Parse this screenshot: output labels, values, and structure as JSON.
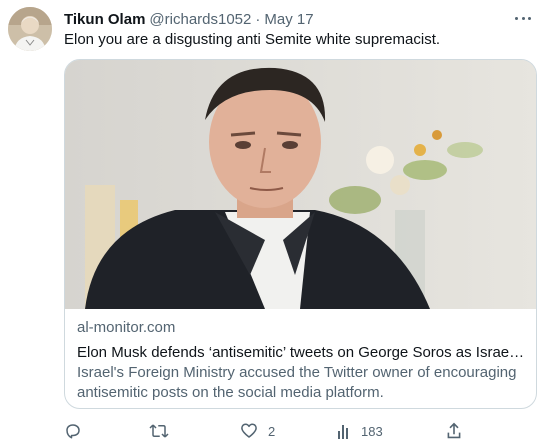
{
  "tweet": {
    "display_name": "Tikun Olam",
    "handle": "@richards1052",
    "separator": "·",
    "date": "May 17",
    "text": "Elon you are a disgusting anti Semite white supremacist.",
    "avatar_icon": "avatar",
    "more_icon": "more-icon"
  },
  "card": {
    "domain": "al-monitor.com",
    "title": "Elon Musk defends ‘antisemitic’ tweets on George Soros as Israel att...",
    "description": "Israel's Foreign Ministry accused the Twitter owner of encouraging antisemitic posts on the social media platform."
  },
  "actions": {
    "reply": {
      "icon": "reply-icon",
      "count": ""
    },
    "retweet": {
      "icon": "retweet-icon",
      "count": ""
    },
    "like": {
      "icon": "heart-icon",
      "count": "2"
    },
    "views": {
      "icon": "views-icon",
      "count": "183"
    },
    "share": {
      "icon": "share-icon"
    }
  },
  "colors": {
    "text": "#0f1419",
    "secondary": "#536471",
    "border": "#cfd9de"
  }
}
